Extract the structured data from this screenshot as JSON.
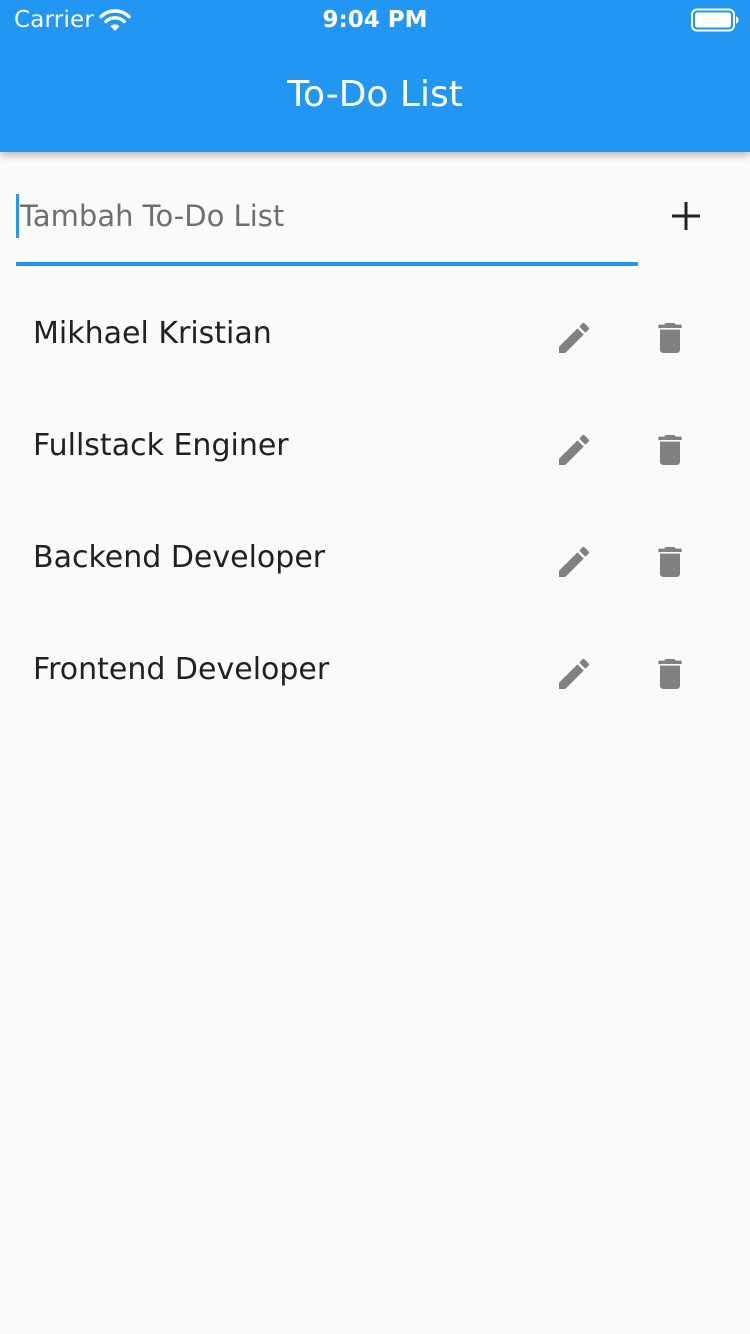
{
  "status_bar": {
    "carrier": "Carrier",
    "time": "9:04 PM",
    "wifi_icon": "wifi-icon",
    "battery_icon": "battery-icon"
  },
  "app_bar": {
    "title": "To-Do List",
    "background": "#2196f3"
  },
  "add_form": {
    "value": "",
    "placeholder": "Tambah To-Do List",
    "add_icon": "plus-icon",
    "accent": "#2196f3"
  },
  "todos": [
    {
      "label": "Mikhael Kristian",
      "edit_icon": "pencil-icon",
      "delete_icon": "trash-icon"
    },
    {
      "label": "Fullstack Enginer",
      "edit_icon": "pencil-icon",
      "delete_icon": "trash-icon"
    },
    {
      "label": "Backend Developer",
      "edit_icon": "pencil-icon",
      "delete_icon": "trash-icon"
    },
    {
      "label": "Frontend Developer",
      "edit_icon": "pencil-icon",
      "delete_icon": "trash-icon"
    }
  ],
  "colors": {
    "icon_gray": "#808080",
    "text": "#212121",
    "background": "#fafafa"
  }
}
